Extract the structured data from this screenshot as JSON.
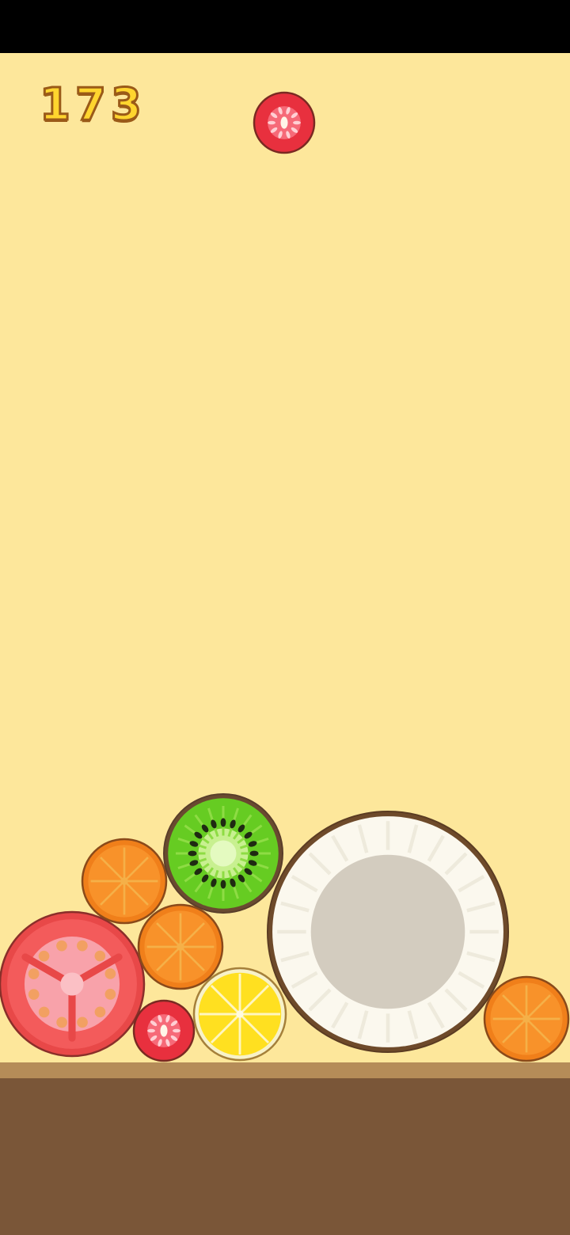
{
  "hud": {
    "score": "173"
  },
  "next_fruit": {
    "kind": "strawberry",
    "icon": "strawberry-icon"
  },
  "board_fruits": [
    {
      "kind": "tomato",
      "icon": "tomato-icon"
    },
    {
      "kind": "orange",
      "icon": "orange-icon"
    },
    {
      "kind": "kiwi",
      "icon": "kiwi-icon"
    },
    {
      "kind": "orange",
      "icon": "orange-icon"
    },
    {
      "kind": "strawberry",
      "icon": "strawberry-icon"
    },
    {
      "kind": "lemon",
      "icon": "lemon-icon"
    },
    {
      "kind": "coconut",
      "icon": "coconut-icon"
    },
    {
      "kind": "orange",
      "icon": "orange-icon"
    }
  ],
  "colors": {
    "background": "#fde79b",
    "ground": "#7a5638",
    "ground_top": "#b58c58",
    "score_fill": "#ffd52e",
    "score_outline": "#9a5a18"
  }
}
